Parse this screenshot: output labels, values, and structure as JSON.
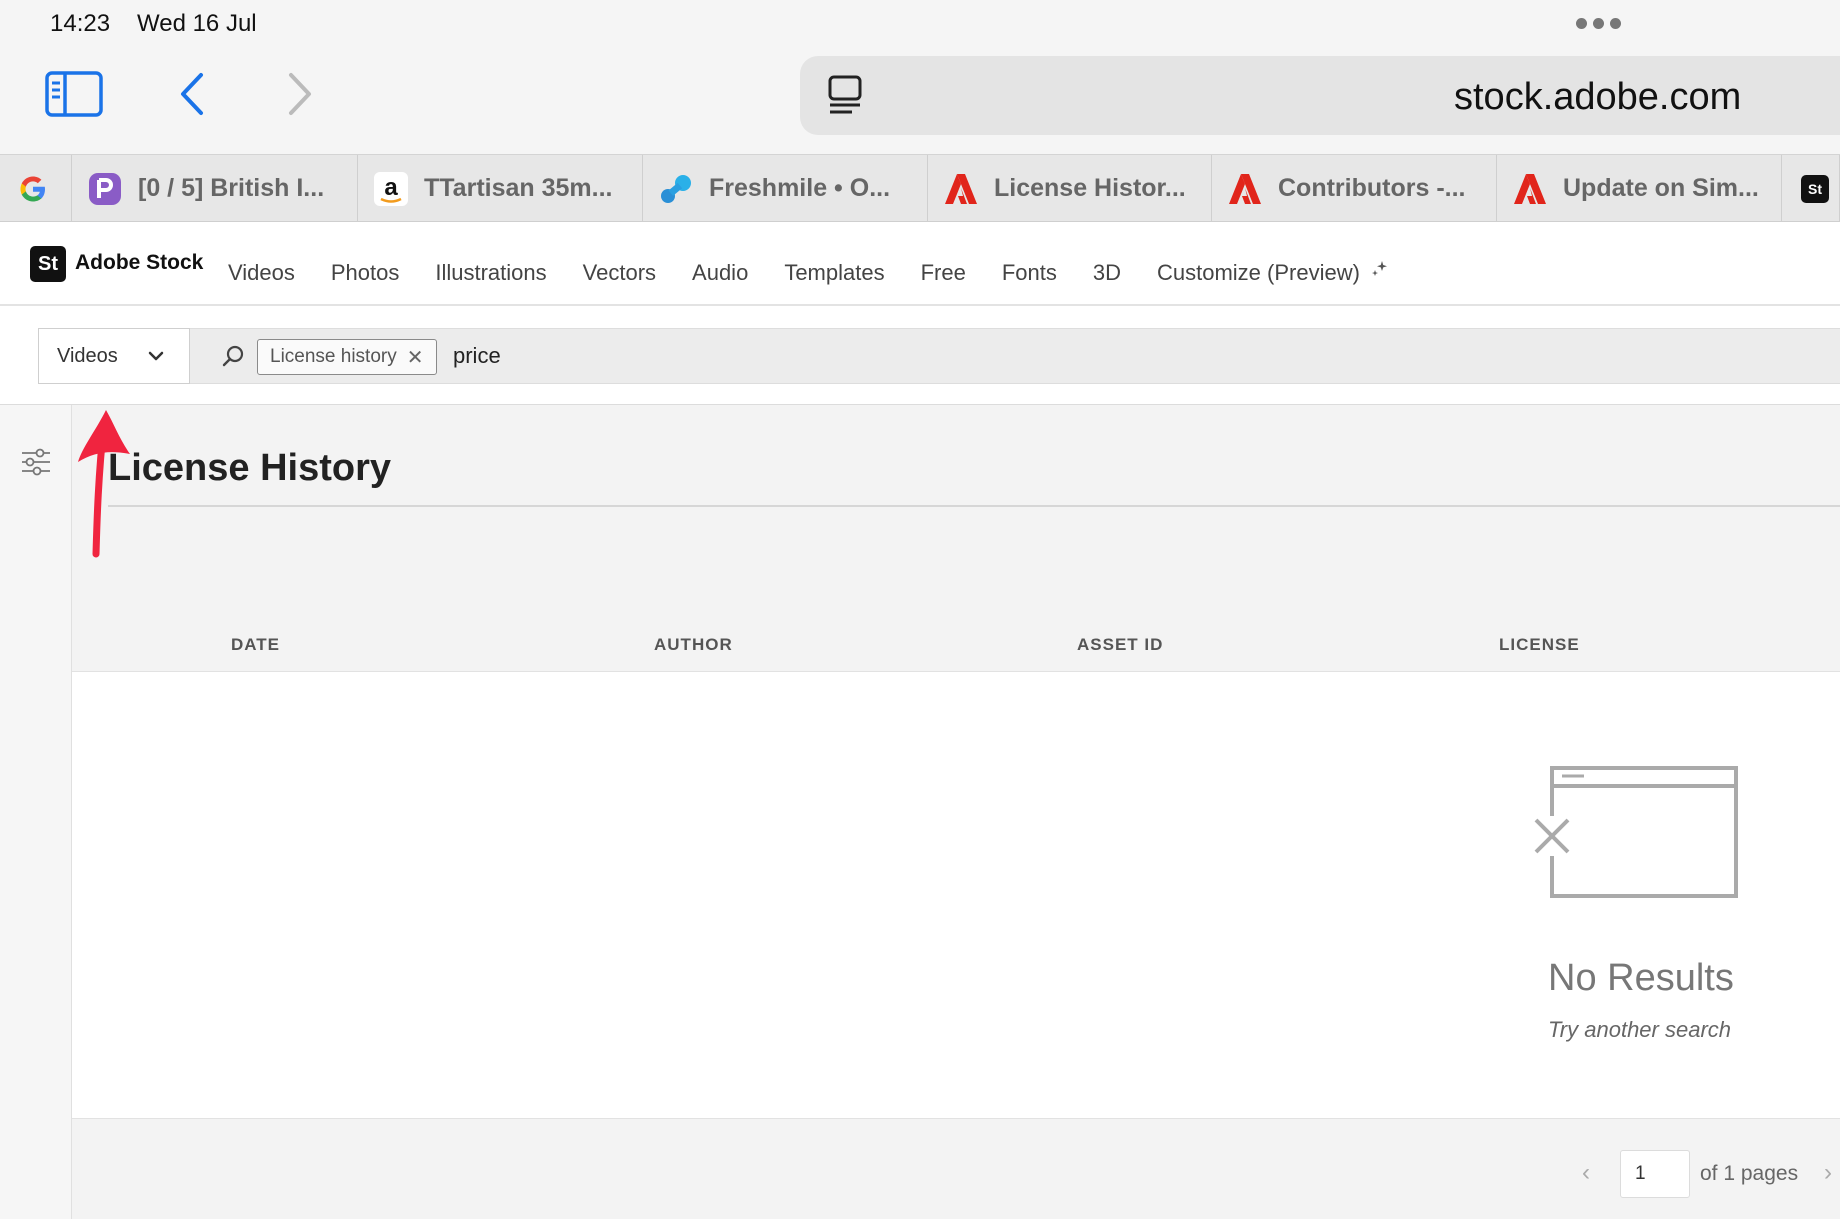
{
  "status_bar": {
    "time": "14:23",
    "date": "Wed 16 Jul"
  },
  "browser": {
    "address": "stock.adobe.com",
    "tabs": [
      {
        "label": "",
        "icon": "google-icon"
      },
      {
        "label": "[0 / 5] British I...",
        "icon": "purple-app-icon"
      },
      {
        "label": "TTartisan 35m...",
        "icon": "amazon-icon"
      },
      {
        "label": "Freshmile • O...",
        "icon": "freshmile-icon"
      },
      {
        "label": "License Histor...",
        "icon": "adobe-icon"
      },
      {
        "label": "Contributors -...",
        "icon": "adobe-icon"
      },
      {
        "label": "Update on Sim...",
        "icon": "adobe-icon"
      },
      {
        "label": "",
        "icon": "adobe-stock-icon"
      }
    ]
  },
  "adobe": {
    "logo_text": "St",
    "brand": "Adobe Stock",
    "nav": [
      "Videos",
      "Photos",
      "Illustrations",
      "Vectors",
      "Audio",
      "Templates",
      "Free",
      "Fonts",
      "3D",
      "Customize (Preview)"
    ]
  },
  "search": {
    "filter_value": "Videos",
    "chip_label": "License history",
    "query": "price"
  },
  "page": {
    "title": "License History",
    "columns": [
      "DATE",
      "AUTHOR",
      "ASSET ID",
      "LICENSE"
    ],
    "empty_title": "No Results",
    "empty_subtitle": "Try another search"
  },
  "pagination": {
    "current_page": "1",
    "of_label": "of 1 pages"
  },
  "colors": {
    "accent_blue": "#1a73e8",
    "adobe_red": "#e1251b",
    "annotation_red": "#f0243f"
  }
}
